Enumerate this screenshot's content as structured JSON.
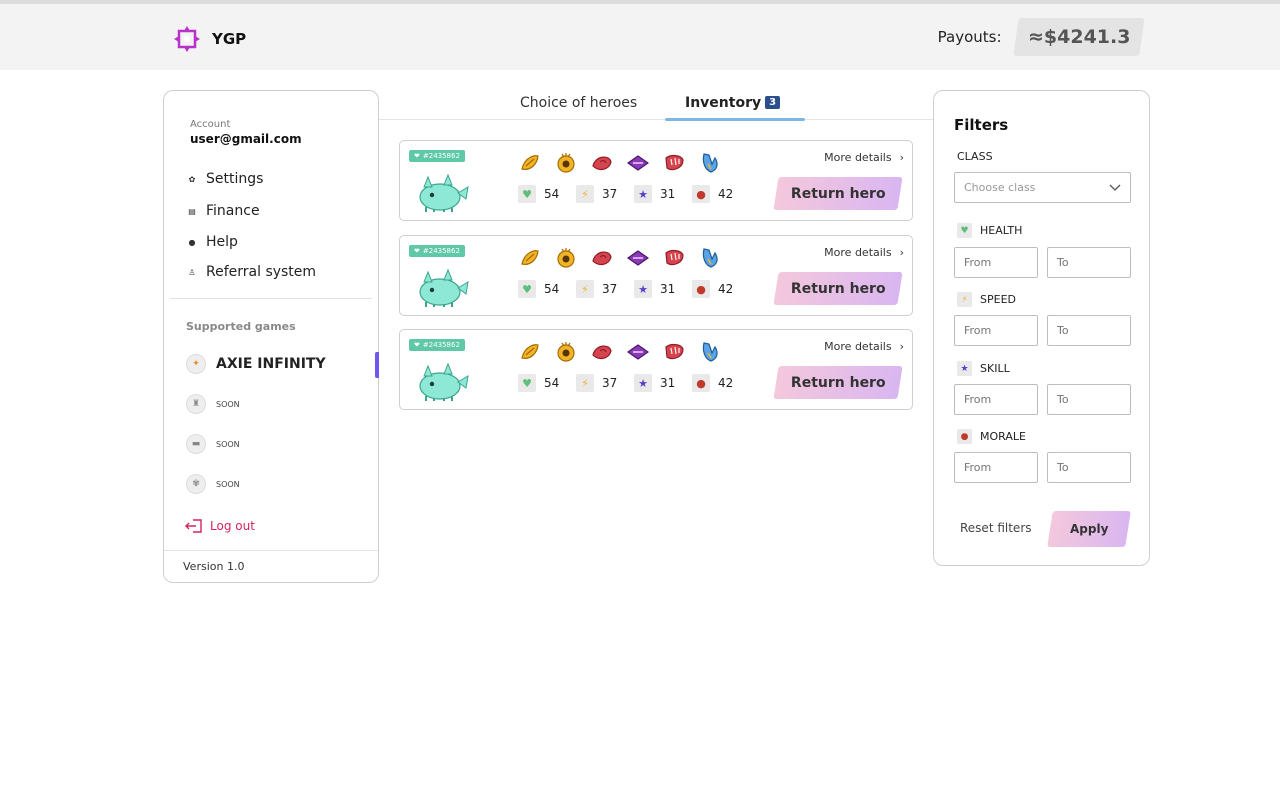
{
  "header": {
    "logo_text": "YGP",
    "payouts_label": "Payouts:",
    "payouts_value": "≈$4241.3"
  },
  "sidebar": {
    "account_label": "Account",
    "email": "user@gmail.com",
    "nav": [
      {
        "label": "Settings",
        "icon": "gear-icon"
      },
      {
        "label": "Finance",
        "icon": "wallet-icon"
      },
      {
        "label": "Help",
        "icon": "help-icon"
      },
      {
        "label": "Referral system",
        "icon": "referral-icon"
      }
    ],
    "supported_games_label": "Supported games",
    "games": [
      {
        "name": "AXIE INFINITY",
        "active": true
      },
      {
        "name": "SOON"
      },
      {
        "name": "SOON"
      },
      {
        "name": "SOON"
      }
    ],
    "logout_label": "Log out",
    "version": "Version 1.0"
  },
  "tabs": {
    "choice_label": "Choice of heroes",
    "inventory_label": "Inventory",
    "inventory_count": "3"
  },
  "heroes": [
    {
      "id": "#2435862",
      "health": "54",
      "speed": "37",
      "skill": "31",
      "morale": "42",
      "more_label": "More details",
      "return_label": "Return hero"
    },
    {
      "id": "#2435862",
      "health": "54",
      "speed": "37",
      "skill": "31",
      "morale": "42",
      "more_label": "More details",
      "return_label": "Return hero"
    },
    {
      "id": "#2435862",
      "health": "54",
      "speed": "37",
      "skill": "31",
      "morale": "42",
      "more_label": "More details",
      "return_label": "Return hero"
    }
  ],
  "filters": {
    "title": "Filters",
    "class_label": "CLASS",
    "class_placeholder": "Choose class",
    "stats": [
      {
        "label": "HEALTH",
        "color": "#5fbf7a"
      },
      {
        "label": "SPEED",
        "color": "#f0b429"
      },
      {
        "label": "SKILL",
        "color": "#5b3fc8"
      },
      {
        "label": "MORALE",
        "color": "#c0392b"
      }
    ],
    "from_placeholder": "From",
    "to_placeholder": "To",
    "reset_label": "Reset filters",
    "apply_label": "Apply"
  },
  "colors": {
    "accent_gradient_start": "#f4c8dc",
    "accent_gradient_end": "#d9b6f1",
    "logout": "#d8235a",
    "badge": "#2b4f8c",
    "hero_id_badge": "#5fc8a6"
  }
}
